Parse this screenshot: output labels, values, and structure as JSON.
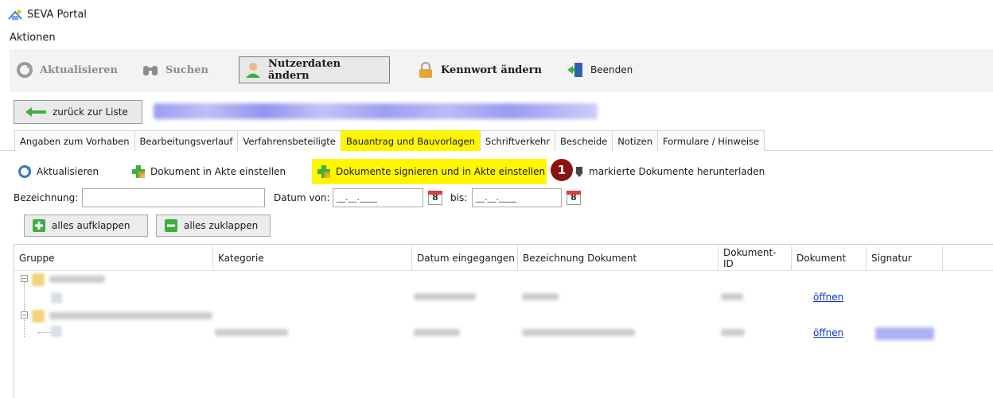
{
  "app": {
    "title": "SEVA Portal"
  },
  "menubar": {
    "items": [
      "Aktionen"
    ]
  },
  "toolbar": {
    "refresh_label": "Aktualisieren",
    "search_label": "Suchen",
    "userdata_label": "Nutzerdaten ändern",
    "password_label": "Kennwort ändern",
    "exit_label": "Beenden"
  },
  "nav": {
    "back_label": "zurück zur Liste"
  },
  "tabs": [
    {
      "label": "Angaben zum Vorhaben"
    },
    {
      "label": "Bearbeitungsverlauf"
    },
    {
      "label": "Verfahrensbeteiligte"
    },
    {
      "label": "Bauantrag und Bauvorlagen"
    },
    {
      "label": "Schriftverkehr"
    },
    {
      "label": "Bescheide"
    },
    {
      "label": "Notizen"
    },
    {
      "label": "Formulare / Hinweise"
    }
  ],
  "subtoolbar": {
    "refresh_label": "Aktualisieren",
    "add_doc_label": "Dokument in Akte einstellen",
    "sign_label": "Dokumente signieren und in Akte einstellen",
    "marker": "1",
    "download_label": "markierte Dokumente herunterladen"
  },
  "filter": {
    "name_label": "Bezeichnung:",
    "date_from_label": "Datum von:",
    "date_from_value": "__.__.____",
    "date_to_label": "bis:",
    "date_to_value": "__.__.____",
    "calendar_glyph": "8"
  },
  "tree_buttons": {
    "expand_label": "alles aufklappen",
    "collapse_label": "alles zuklappen"
  },
  "table": {
    "headers": [
      "Gruppe",
      "Kategorie",
      "Datum eingegangen",
      "Bezeichnung Dokument",
      "Dokument-ID",
      "Dokument",
      "Signatur"
    ],
    "rows": [
      {
        "open_label": "öffnen"
      },
      {
        "open_label": "öffnen"
      }
    ]
  },
  "colors": {
    "highlight": "#fff600",
    "marker": "#8a1212",
    "link": "#0b31c8"
  }
}
